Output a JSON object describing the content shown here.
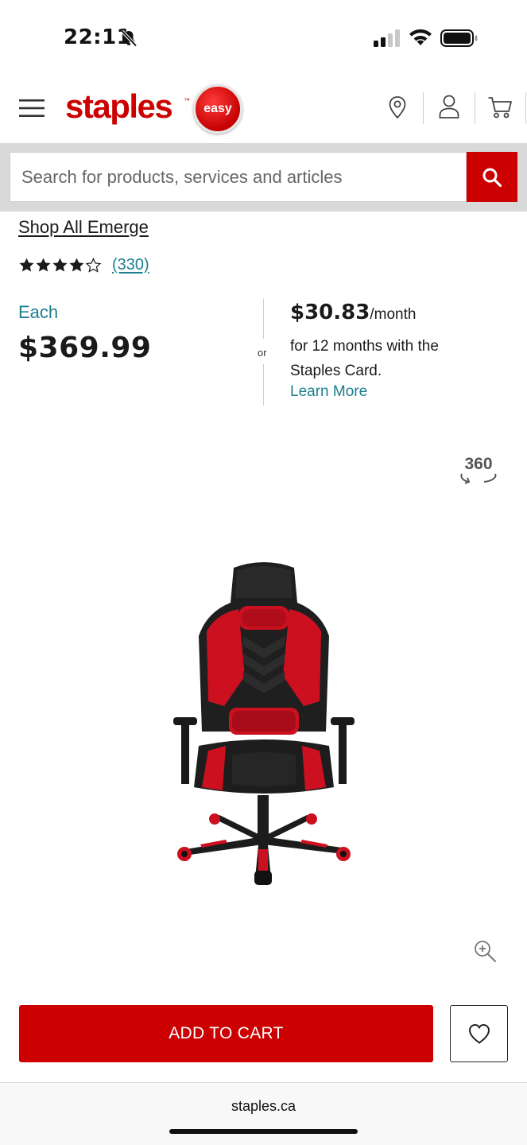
{
  "status_bar": {
    "time": "22:11"
  },
  "header": {
    "logo_text": "staples",
    "logo_tm": "™",
    "easy_button_label": "easy"
  },
  "search": {
    "placeholder": "Search for products, services and articles"
  },
  "product": {
    "shop_all_link": "Shop All Emerge",
    "rating_stars": 4,
    "rating_max": 5,
    "review_count": "(330)",
    "price_label": "Each",
    "price": "$369.99",
    "or_text": "or",
    "monthly_amount": "$30.83",
    "monthly_per": "/month",
    "monthly_terms": "for 12 months with the Staples Card.",
    "learn_more": "Learn More",
    "view_360_label": "360",
    "image_name": "black-red-gaming-chair"
  },
  "actions": {
    "add_to_cart": "ADD TO CART"
  },
  "browser": {
    "url": "staples.ca"
  },
  "colors": {
    "brand_red": "#cc0000",
    "link_teal": "#1b7f8f",
    "text_dark": "#1a1a1a"
  }
}
